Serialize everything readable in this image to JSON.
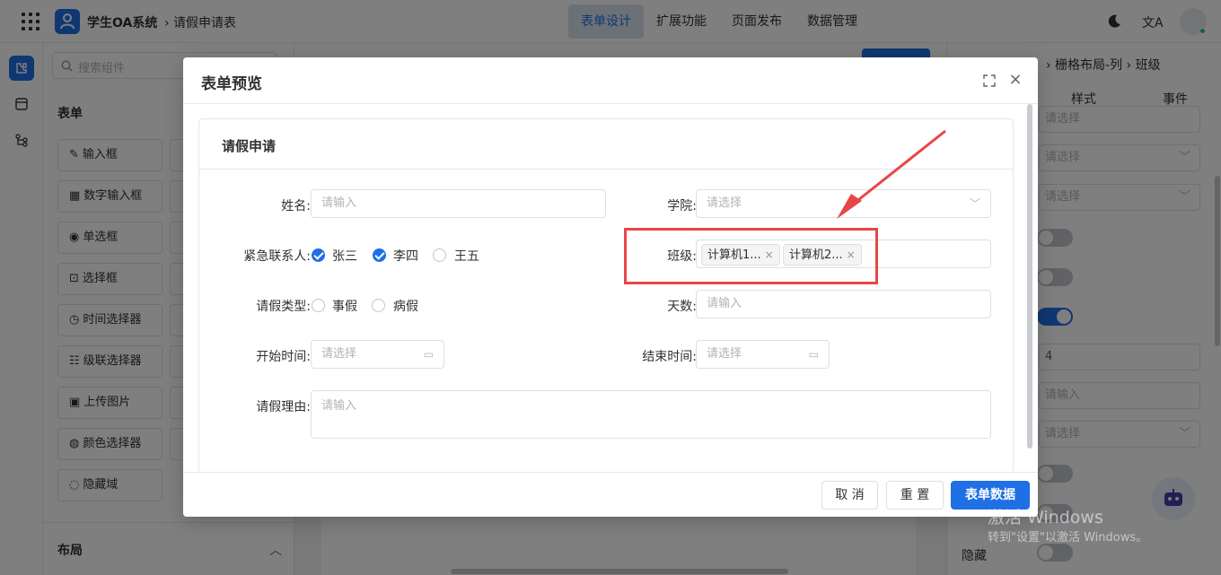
{
  "header": {
    "app_title": "学生OA系统",
    "breadcrumb": "› 请假申请表",
    "nav": [
      "表单设计",
      "扩展功能",
      "页面发布",
      "数据管理"
    ],
    "active_nav": 0,
    "translate_glyph": "文A"
  },
  "sidebar": {
    "search_placeholder": "搜索组件",
    "section_form": "表单",
    "components": [
      "输入框",
      "数字输入框",
      "单选框",
      "选择框",
      "时间选择器",
      "级联选择器",
      "上传图片",
      "颜色选择器",
      "隐藏域"
    ],
    "section_layout": "布局"
  },
  "props": {
    "breadcrumb": "› 栅格布局-列 › 班级",
    "tab_style": "样式",
    "tab_event": "事件",
    "fields": [
      "请选择",
      "请选择",
      "请选择",
      "4",
      "请输入",
      "请选择"
    ],
    "hidden_label": "隐藏"
  },
  "modal": {
    "title": "表单预览",
    "card_title": "请假申请",
    "name_label": "姓名:",
    "name_placeholder": "请输入",
    "college_label": "学院:",
    "college_placeholder": "请选择",
    "contact_label": "紧急联系人:",
    "contacts": [
      {
        "label": "张三",
        "checked": true
      },
      {
        "label": "李四",
        "checked": true
      },
      {
        "label": "王五",
        "checked": false
      }
    ],
    "class_label": "班级:",
    "class_tags": [
      "计算机1...",
      "计算机2..."
    ],
    "leave_type_label": "请假类型:",
    "leave_types": [
      "事假",
      "病假"
    ],
    "days_label": "天数:",
    "days_placeholder": "请输入",
    "start_label": "开始时间:",
    "start_placeholder": "请选择",
    "end_label": "结束时间:",
    "end_placeholder": "请选择",
    "reason_label": "请假理由:",
    "reason_placeholder": "请输入",
    "btn_cancel": "取 消",
    "btn_reset": "重 置",
    "btn_data": "表单数据"
  },
  "watermark": {
    "line1": "激活 Windows",
    "line2": "转到\"设置\"以激活 Windows。"
  },
  "colors": {
    "primary": "#1f6fe5",
    "annotation": "#e84646"
  }
}
